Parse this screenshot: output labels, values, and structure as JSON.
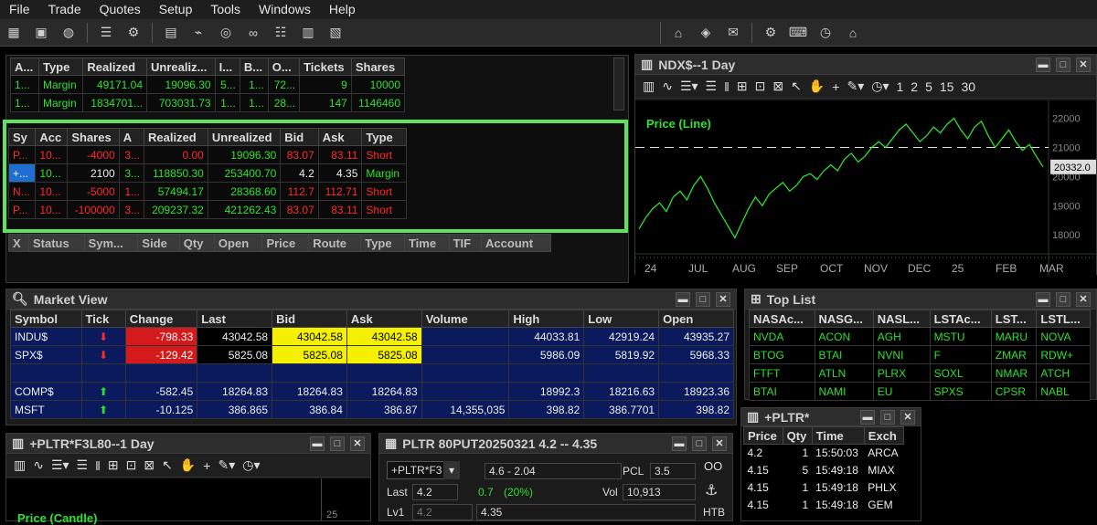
{
  "menu": [
    "File",
    "Trade",
    "Quotes",
    "Setup",
    "Tools",
    "Windows",
    "Help"
  ],
  "toolbar_left": [
    "grid-icon",
    "card-icon",
    "globe-icon",
    "list-icon",
    "gear-icon",
    "doc-icon",
    "plug-icon",
    "scan-icon",
    "link-icon",
    "sliders-icon",
    "bars-icon",
    "table-icon"
  ],
  "toolbar_right": [
    "basket-icon",
    "tag-icon",
    "mail-icon",
    "gear-icon",
    "keyboard-icon",
    "clock-icon",
    "home-icon"
  ],
  "accounts": {
    "headers": [
      "A...",
      "Type",
      "Realized",
      "Unrealiz...",
      "I...",
      "B...",
      "O...",
      "Tickets",
      "Shares"
    ],
    "rows": [
      [
        "1...",
        "Margin",
        "49171.04",
        "19096.30",
        "5...",
        "1...",
        "72...",
        "9",
        "10000"
      ],
      [
        "1...",
        "Margin",
        "1834701...",
        "703031.73",
        "1...",
        "1...",
        "28...",
        "147",
        "1146460"
      ]
    ]
  },
  "positions": {
    "headers": [
      "Sy",
      "Acc",
      "Shares",
      "A",
      "Realized",
      "Unrealized",
      "Bid",
      "Ask",
      "Type"
    ],
    "rows": [
      [
        "P...",
        "10...",
        "-4000",
        "3...",
        "0.00",
        "19096.30",
        "83.07",
        "83.11",
        "Short"
      ],
      [
        "+...",
        "10...",
        "2100",
        "3...",
        "118850.30",
        "253400.70",
        "4.2",
        "4.35",
        "Margin"
      ],
      [
        "N...",
        "10...",
        "-5000",
        "1...",
        "57494.17",
        "28368.60",
        "112.7",
        "112.71",
        "Short"
      ],
      [
        "P...",
        "10...",
        "-100000",
        "3...",
        "209237.32",
        "421262.43",
        "83.07",
        "83.11",
        "Short"
      ]
    ]
  },
  "orders": {
    "headers": [
      "X",
      "Status",
      "Sym...",
      "Side",
      "Qty",
      "Open",
      "Price",
      "Route",
      "Type",
      "Time",
      "TIF",
      "Account"
    ]
  },
  "ndx_chart": {
    "title": "NDX$--1 Day",
    "label": "Price (Line)",
    "last_price": "20332.0",
    "tool_numbers": [
      "1",
      "2",
      "5",
      "15",
      "30"
    ],
    "chart_data": {
      "type": "line",
      "x_labels": [
        "24",
        "JUL",
        "AUG",
        "SEP",
        "OCT",
        "NOV",
        "DEC",
        "25",
        "FEB",
        "MAR"
      ],
      "y_ticks": [
        "22000",
        "21000",
        "20000",
        "19000",
        "18000"
      ],
      "ylim": [
        17600,
        22300
      ],
      "values": [
        18200,
        18600,
        18900,
        19100,
        18800,
        19300,
        19500,
        19200,
        19700,
        20000,
        19600,
        19100,
        18700,
        18300,
        17900,
        18400,
        18900,
        19300,
        19000,
        19400,
        19600,
        19800,
        19500,
        19700,
        20000,
        20100,
        19900,
        20200,
        20400,
        20200,
        20600,
        20800,
        20500,
        20700,
        21000,
        21200,
        21000,
        21300,
        21600,
        21800,
        21500,
        21200,
        21400,
        21700,
        21500,
        21800,
        22000,
        21600,
        21300,
        21700,
        21900,
        21400,
        21000,
        21300,
        21600,
        21200,
        20900,
        21100,
        20700,
        20332
      ],
      "reference_line": 21000
    }
  },
  "market_view": {
    "title": "Market View",
    "headers": [
      "Symbol",
      "Tick",
      "Change",
      "Last",
      "Bid",
      "Ask",
      "Volume",
      "High",
      "Low",
      "Open"
    ],
    "rows": [
      [
        "INDU$",
        "down",
        "-798.33",
        "43042.58",
        "43042.58",
        "43042.58",
        "",
        "44033.81",
        "42919.24",
        "43935.27"
      ],
      [
        "SPX$",
        "down",
        "-129.42",
        "5825.08",
        "5825.08",
        "5825.08",
        "",
        "5986.09",
        "5819.92",
        "5968.33"
      ],
      [
        "",
        "",
        "",
        "",
        "",
        "",
        "",
        "",
        "",
        ""
      ],
      [
        "COMP$",
        "up",
        "-582.45",
        "18264.83",
        "18264.83",
        "18264.83",
        "",
        "18992.3",
        "18216.63",
        "18923.36"
      ],
      [
        "MSFT",
        "up",
        "-10.125",
        "386.865",
        "386.84",
        "386.87",
        "14,355,035",
        "398.82",
        "386.7701",
        "398.82"
      ]
    ]
  },
  "top_list": {
    "title": "Top List",
    "headers": [
      "NASAc...",
      "NASG...",
      "NASL...",
      "LSTAc...",
      "LST...",
      "LSTL..."
    ],
    "rows": [
      [
        "NVDA",
        "ACON",
        "AGH",
        "MSTU",
        "MARU",
        "NOVA"
      ],
      [
        "BTOG",
        "BTAI",
        "NVNI",
        "F",
        "ZMAR",
        "RDW+"
      ],
      [
        "FTFT",
        "ATLN",
        "PLRX",
        "SOXL",
        "NMAR",
        "ATCH"
      ],
      [
        "BTAI",
        "NAMI",
        "EU",
        "SPXS",
        "CPSR",
        "NABL"
      ]
    ]
  },
  "pltr_chart": {
    "title": "+PLTR*F3L80--1 Day",
    "label": "Price (Candle)",
    "tick_label": "25"
  },
  "option_window": {
    "title": "PLTR 80PUT20250321 4.2 -- 4.35",
    "symbol": "+PLTR*F3",
    "range": "4.6 - 2.04",
    "pcl_label": "PCL",
    "pcl": "3.5",
    "oo": "OO",
    "last_label": "Last",
    "last": "4.2",
    "change": "0.7",
    "change_pct": "(20%)",
    "vol_label": "Vol",
    "vol": "10,913",
    "lv1_label": "Lv1",
    "lv1_bid": "4.2",
    "lv1_ask": "4.35",
    "htb": "HTB"
  },
  "time_sales": {
    "title": "+PLTR*",
    "headers": [
      "Price",
      "Qty",
      "Time",
      "Exch"
    ],
    "rows": [
      [
        "4.2",
        "1",
        "15:50:03",
        "ARCA"
      ],
      [
        "4.15",
        "5",
        "15:49:18",
        "MIAX"
      ],
      [
        "4.15",
        "1",
        "15:49:18",
        "PHLX"
      ],
      [
        "4.15",
        "1",
        "15:49:18",
        "GEM"
      ]
    ]
  },
  "colors": {
    "highlight": "#5ee35e",
    "bid_yellow": "#f5f000",
    "neg_red": "#d41a1a",
    "pos_green": "#2de12d",
    "navy": "#0a1a5c"
  }
}
